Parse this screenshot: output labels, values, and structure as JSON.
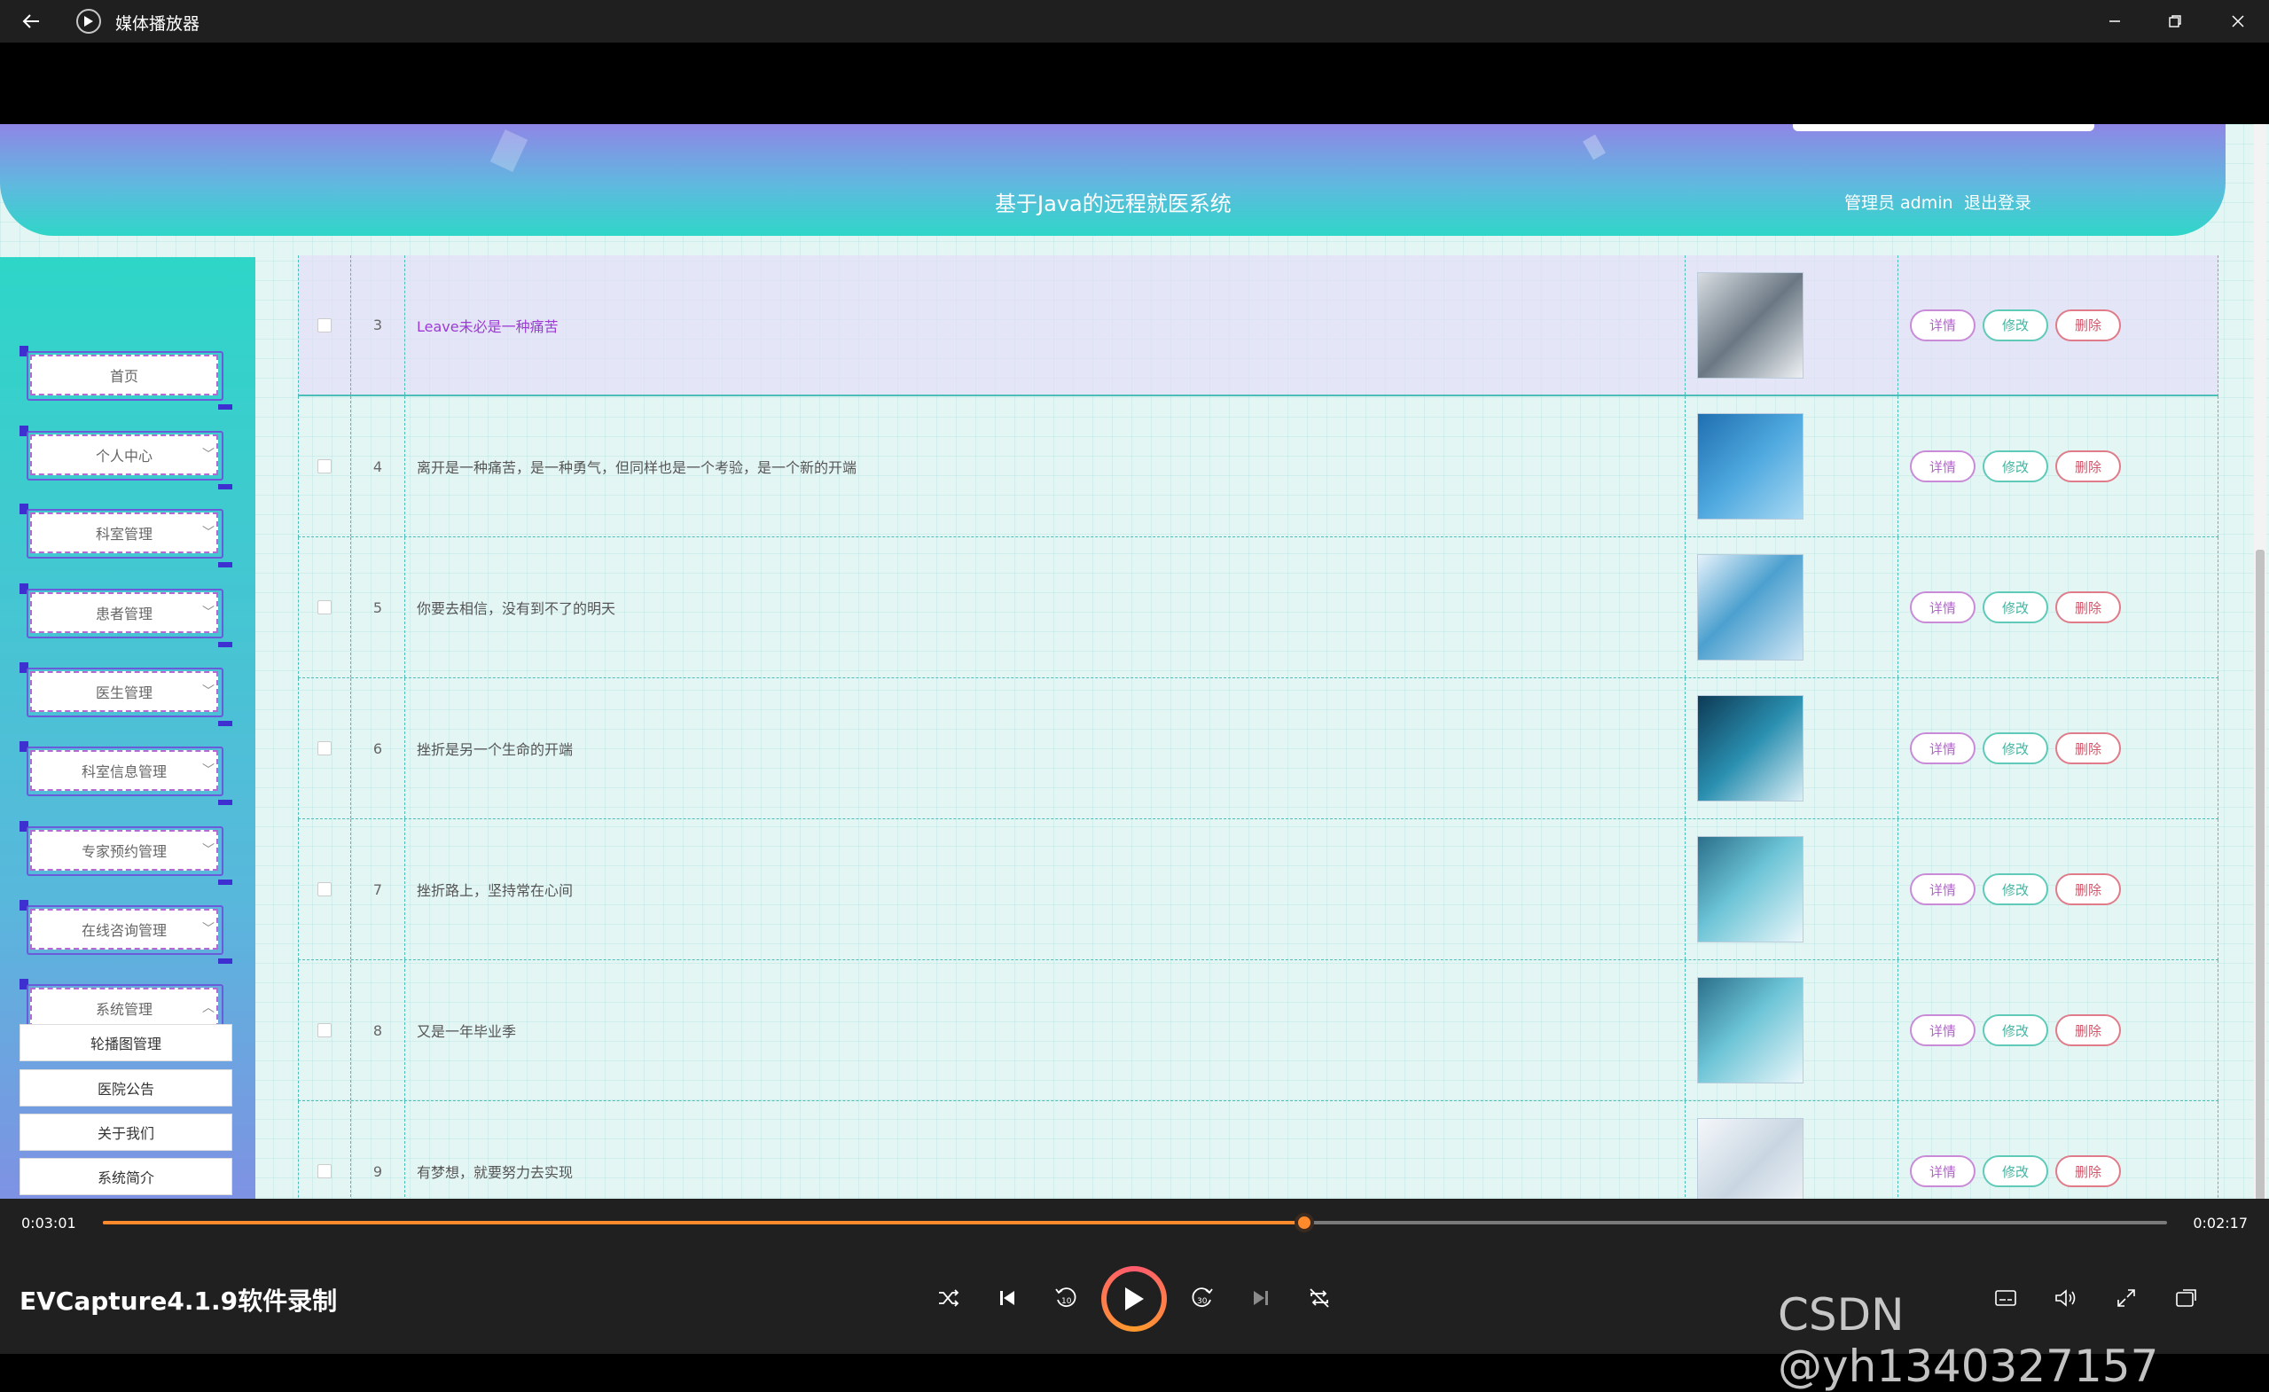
{
  "window": {
    "title": "媒体播放器"
  },
  "app": {
    "title": "基于Java的远程就医系统",
    "user": "管理员 admin",
    "logout": "退出登录"
  },
  "sidebar": {
    "items": [
      {
        "label": "首页",
        "expandable": false
      },
      {
        "label": "个人中心",
        "expandable": true
      },
      {
        "label": "科室管理",
        "expandable": true
      },
      {
        "label": "患者管理",
        "expandable": true
      },
      {
        "label": "医生管理",
        "expandable": true
      },
      {
        "label": "科室信息管理",
        "expandable": true
      },
      {
        "label": "专家预约管理",
        "expandable": true
      },
      {
        "label": "在线咨询管理",
        "expandable": true
      },
      {
        "label": "系统管理",
        "expandable": true,
        "expanded": true
      }
    ],
    "subitems": [
      "轮播图管理",
      "医院公告",
      "关于我们",
      "系统简介"
    ]
  },
  "table": {
    "rows": [
      {
        "index": "3",
        "title": "Leave未必是一种痛苦",
        "image": "robot-surgery-image"
      },
      {
        "index": "4",
        "title": "离开是一种痛苦，是一种勇气，但同样也是一个考验，是一个新的开端",
        "image": "medical-presentation-image"
      },
      {
        "index": "5",
        "title": "你要去相信，没有到不了的明天",
        "image": "doctor-tablet-image"
      },
      {
        "index": "6",
        "title": "挫折是另一个生命的开端",
        "image": "doctor-stethoscope-image"
      },
      {
        "index": "7",
        "title": "挫折路上，坚持常在心间",
        "image": "medical-tech-image"
      },
      {
        "index": "8",
        "title": "又是一年毕业季",
        "image": "medical-tech-image-2"
      },
      {
        "index": "9",
        "title": "有梦想，就要努力去实现",
        "image": "stethoscope-icons-image"
      }
    ],
    "buttons": {
      "detail": "详情",
      "edit": "修改",
      "delete": "删除"
    },
    "active_row": 0
  },
  "player": {
    "elapsed": "0:03:01",
    "remaining": "0:02:17",
    "progress": 0.582,
    "media_title": "EVCapture4.1.9软件录制",
    "watermark": "CSDN @yh1340327157",
    "colors": {
      "accent": "#ff8a2c"
    }
  }
}
